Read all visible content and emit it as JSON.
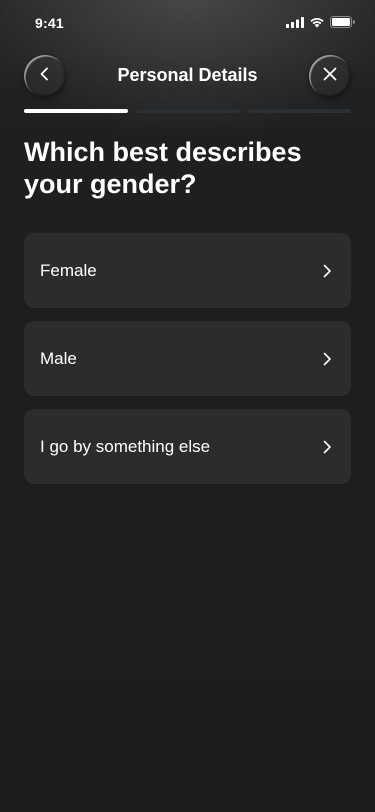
{
  "status_bar": {
    "time": "9:41"
  },
  "header": {
    "title": "Personal Details"
  },
  "progress": {
    "segments": 3,
    "current": 1
  },
  "question": {
    "text": "Which best describes your gender?"
  },
  "options": [
    {
      "label": "Female"
    },
    {
      "label": "Male"
    },
    {
      "label": "I go by something else"
    }
  ],
  "colors": {
    "background": "#1b1d1f",
    "card": "#2a2c2e",
    "progress_active": "#ffffff",
    "progress_inactive": "#2c2f32",
    "text": "#ffffff"
  },
  "icons": {
    "back": "chevron-left-icon",
    "close": "close-icon",
    "option": "chevron-right-icon",
    "signal": "cellular-signal-icon",
    "wifi": "wifi-icon",
    "battery": "battery-icon"
  }
}
